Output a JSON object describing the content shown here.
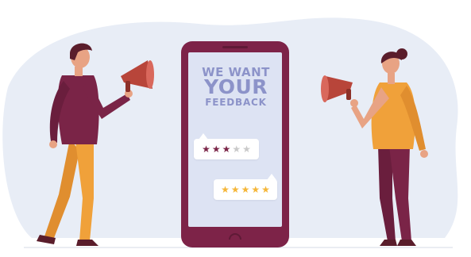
{
  "headline": {
    "line1": "WE WANT",
    "line2": "YOUR",
    "line3": "FEEDBACK"
  },
  "ratings": [
    {
      "filled": 3,
      "total": 5,
      "filled_color": "#7a2447",
      "empty_color": "#c9c9c9"
    },
    {
      "filled": 5,
      "total": 5,
      "filled_color": "#f5b638",
      "empty_color": "#c9c9c9"
    }
  ],
  "colors": {
    "background_blob": "#e8edf6",
    "phone_frame": "#7d2348",
    "phone_screen": "#dde3f3",
    "megaphone": "#b8453a",
    "shirt_man": "#7a2447",
    "pants_man": "#f0a13a",
    "shirt_woman": "#f0a13a",
    "pants_woman": "#7a2447",
    "skin": "#e8a384",
    "hair": "#5a1d2b"
  }
}
